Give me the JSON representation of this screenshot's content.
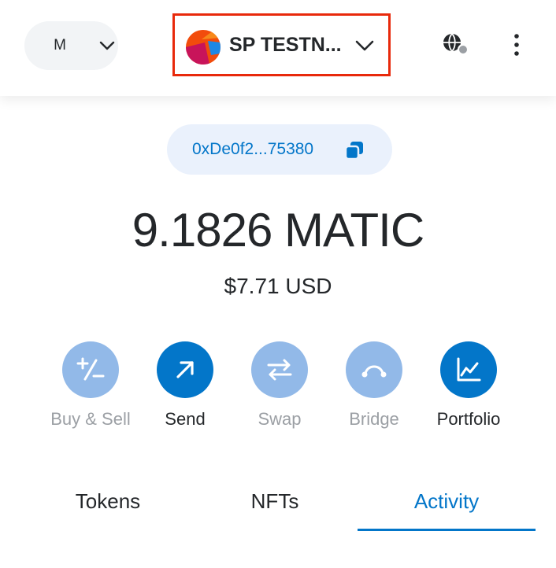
{
  "header": {
    "network": {
      "label": "M",
      "icon": "chevron-down-icon"
    },
    "account": {
      "name": "SP TESTN...",
      "avatar": "jazzicon-avatar",
      "icon": "chevron-down-icon"
    },
    "connection_icon": "globe-icon",
    "menu_icon": "kebab-menu-icon"
  },
  "address": {
    "text": "0xDe0f2...75380",
    "icon": "copy-icon"
  },
  "balance": {
    "primary": "9.1826 MATIC",
    "secondary": "$7.71 USD"
  },
  "actions": [
    {
      "label": "Buy & Sell",
      "icon": "plus-minus-icon",
      "enabled": false
    },
    {
      "label": "Send",
      "icon": "arrow-up-right-icon",
      "enabled": true
    },
    {
      "label": "Swap",
      "icon": "swap-arrows-icon",
      "enabled": false
    },
    {
      "label": "Bridge",
      "icon": "bridge-icon",
      "enabled": false
    },
    {
      "label": "Portfolio",
      "icon": "chart-line-icon",
      "enabled": true
    }
  ],
  "tabs": [
    {
      "label": "Tokens",
      "active": false
    },
    {
      "label": "NFTs",
      "active": false
    },
    {
      "label": "Activity",
      "active": true
    }
  ],
  "colors": {
    "accent": "#0376c9",
    "accent_muted": "#92b9e8",
    "highlight_border": "#e8290b",
    "text": "#24272a",
    "text_muted": "#9b9fa4",
    "pill_bg": "#eaf1fc"
  }
}
